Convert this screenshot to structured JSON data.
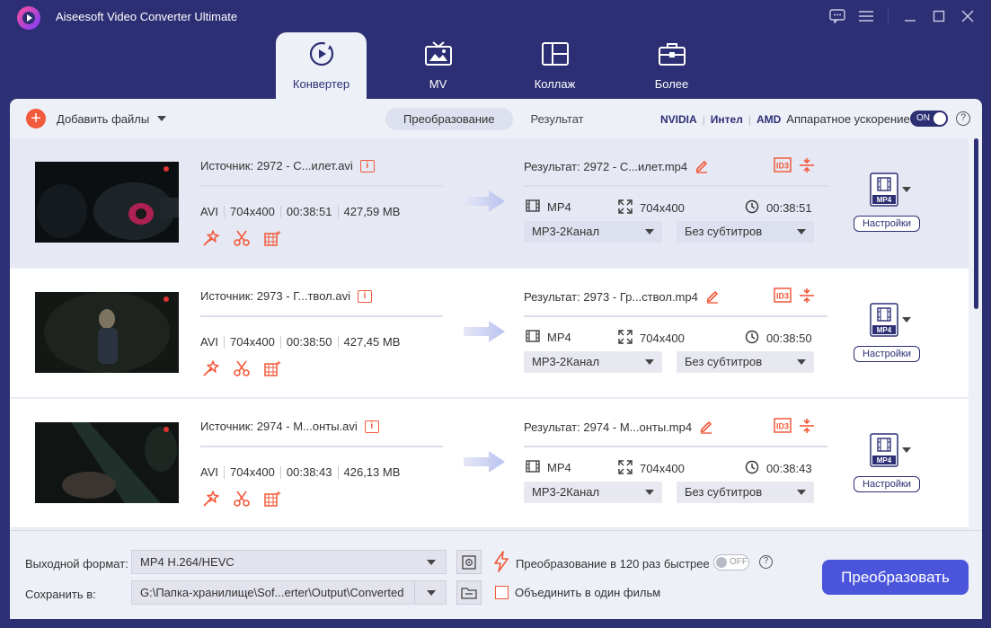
{
  "app": {
    "title": "Aiseesoft Video Converter Ultimate"
  },
  "tabs": [
    {
      "label": "Конвертер",
      "icon": "converter-icon",
      "active": true
    },
    {
      "label": "MV",
      "icon": "tv-icon",
      "active": false
    },
    {
      "label": "Коллаж",
      "icon": "collage-icon",
      "active": false
    },
    {
      "label": "Более",
      "icon": "toolbox-icon",
      "active": false
    }
  ],
  "toolbar": {
    "add_files": "Добавить файлы",
    "seg_convert": "Преобразование",
    "seg_result": "Результат",
    "hw_nvidia": "NVIDIA",
    "hw_intel": "Интел",
    "hw_amd": "AMD",
    "hw_label": "Аппаратное ускорение",
    "hw_toggle": "ON",
    "help": "?"
  },
  "files": [
    {
      "source": "Источник: 2972 - С...илет.avi",
      "format": "AVI",
      "resolution": "704x400",
      "duration": "00:38:51",
      "size": "427,59 MB",
      "result": "Результат: 2972 - С...илет.mp4",
      "out_format": "MP4",
      "out_resolution": "704x400",
      "out_duration": "00:38:51",
      "audio": "MP3-2Канал",
      "subtitles": "Без субтитров",
      "badge": "MP4",
      "settings": "Настройки",
      "selected": true
    },
    {
      "source": "Источник: 2973 - Г...твол.avi",
      "format": "AVI",
      "resolution": "704x400",
      "duration": "00:38:50",
      "size": "427,45 MB",
      "result": "Результат: 2973 - Гр...ствол.mp4",
      "out_format": "MP4",
      "out_resolution": "704x400",
      "out_duration": "00:38:50",
      "audio": "MP3-2Канал",
      "subtitles": "Без субтитров",
      "badge": "MP4",
      "settings": "Настройки",
      "selected": false
    },
    {
      "source": "Источник: 2974 - М...онты.avi",
      "format": "AVI",
      "resolution": "704x400",
      "duration": "00:38:43",
      "size": "426,13 MB",
      "result": "Результат: 2974 - М...онты.mp4",
      "out_format": "MP4",
      "out_resolution": "704x400",
      "out_duration": "00:38:43",
      "audio": "MP3-2Канал",
      "subtitles": "Без субтитров",
      "badge": "MP4",
      "settings": "Настройки",
      "selected": false
    }
  ],
  "bottom": {
    "output_format_label": "Выходной формат:",
    "output_format_value": "MP4 H.264/HEVC",
    "save_to_label": "Сохранить в:",
    "save_to_value": "G:\\Папка-хранилище\\Sof...erter\\Output\\Converted",
    "fast_label": "Преобразование в 120 раз быстрее",
    "fast_toggle": "OFF",
    "merge_label": "Объединить в один фильм",
    "convert_button": "Преобразовать"
  },
  "colors": {
    "frame": "#2d2f74",
    "accent": "#f15a3a",
    "primary": "#4b55dc",
    "panel": "#eef0f8"
  }
}
